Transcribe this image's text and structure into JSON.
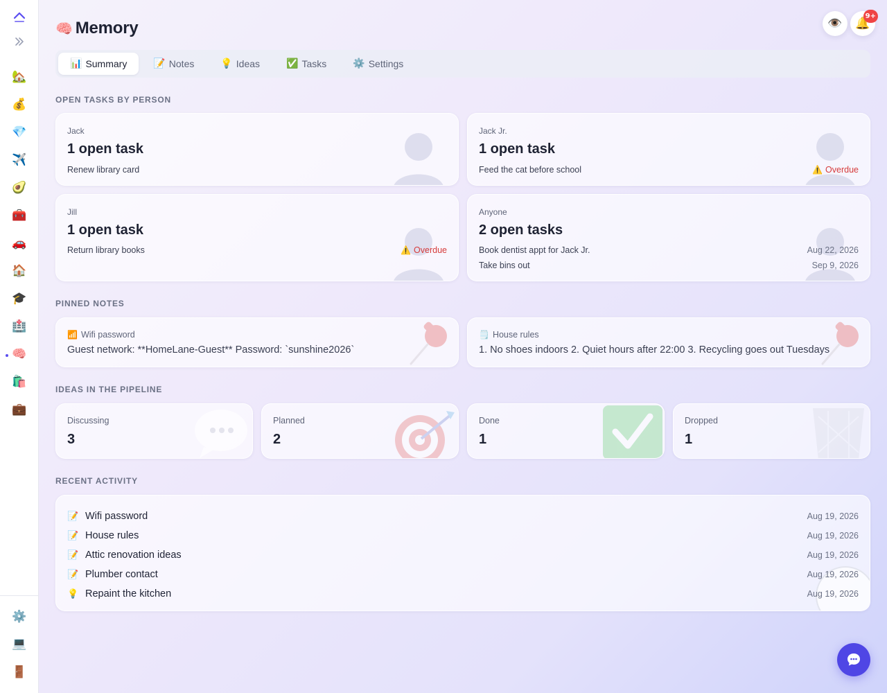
{
  "sidebar": {
    "logo_icon": "chevron-up-logo-icon",
    "expand_icon": "double-chevron-right-icon",
    "items": [
      {
        "name": "home-garden",
        "icon": "🏡"
      },
      {
        "name": "money",
        "icon": "💰"
      },
      {
        "name": "gem",
        "icon": "💎"
      },
      {
        "name": "travel",
        "icon": "✈️"
      },
      {
        "name": "food",
        "icon": "🥑"
      },
      {
        "name": "toolbox",
        "icon": "🧰"
      },
      {
        "name": "car",
        "icon": "🚗"
      },
      {
        "name": "house",
        "icon": "🏠"
      },
      {
        "name": "education",
        "icon": "🎓"
      },
      {
        "name": "health",
        "icon": "🏥"
      },
      {
        "name": "memory",
        "icon": "🧠",
        "active": true
      },
      {
        "name": "shopping",
        "icon": "🛍️"
      },
      {
        "name": "work",
        "icon": "💼"
      }
    ],
    "bottom_items": [
      {
        "name": "settings",
        "icon": "⚙️"
      },
      {
        "name": "computer",
        "icon": "💻"
      },
      {
        "name": "logout-door",
        "icon": "🚪"
      }
    ]
  },
  "header": {
    "title_emoji": "🧠",
    "title": "Memory",
    "eye_icon": "👁️",
    "bell_icon": "🔔",
    "notification_badge": "9+"
  },
  "tabs": [
    {
      "emoji": "📊",
      "label": "Summary",
      "active": true
    },
    {
      "emoji": "📝",
      "label": "Notes"
    },
    {
      "emoji": "💡",
      "label": "Ideas"
    },
    {
      "emoji": "✅",
      "label": "Tasks"
    },
    {
      "emoji": "⚙️",
      "label": "Settings"
    }
  ],
  "open_tasks": {
    "section_label": "OPEN TASKS BY PERSON",
    "overdue_emoji": "⚠️",
    "cards": [
      {
        "person": "Jack",
        "count_label": "1 open task",
        "tasks": [
          {
            "text": "Renew library card",
            "status": ""
          }
        ]
      },
      {
        "person": "Jack Jr.",
        "count_label": "1 open task",
        "tasks": [
          {
            "text": "Feed the cat before school",
            "status": "Overdue"
          }
        ]
      },
      {
        "person": "Jill",
        "count_label": "1 open task",
        "tasks": [
          {
            "text": "Return library books",
            "status": "Overdue"
          }
        ]
      },
      {
        "person": "Anyone",
        "count_label": "2 open tasks",
        "tasks": [
          {
            "text": "Book dentist appt for Jack Jr.",
            "status": "Aug 22, 2026"
          },
          {
            "text": "Take bins out",
            "status": "Sep 9, 2026"
          }
        ]
      }
    ]
  },
  "pinned_notes": {
    "section_label": "PINNED NOTES",
    "notes": [
      {
        "emoji": "📶",
        "title": "Wifi password",
        "body": "Guest network: **HomeLane-Guest** Password: `sunshine2026`"
      },
      {
        "emoji": "🗒️",
        "title": "House rules",
        "body": "1. No shoes indoors 2. Quiet hours after 22:00 3. Recycling goes out Tuesdays"
      }
    ]
  },
  "ideas": {
    "section_label": "IDEAS IN THE PIPELINE",
    "stages": [
      {
        "label": "Discussing",
        "count": "3"
      },
      {
        "label": "Planned",
        "count": "2"
      },
      {
        "label": "Done",
        "count": "1"
      },
      {
        "label": "Dropped",
        "count": "1"
      }
    ]
  },
  "recent_activity": {
    "section_label": "RECENT ACTIVITY",
    "items": [
      {
        "emoji": "📝",
        "title": "Wifi password",
        "date": "Aug 19, 2026"
      },
      {
        "emoji": "📝",
        "title": "House rules",
        "date": "Aug 19, 2026"
      },
      {
        "emoji": "📝",
        "title": "Attic renovation ideas",
        "date": "Aug 19, 2026"
      },
      {
        "emoji": "📝",
        "title": "Plumber contact",
        "date": "Aug 19, 2026"
      },
      {
        "emoji": "💡",
        "title": "Repaint the kitchen",
        "date": "Aug 19, 2026"
      }
    ]
  },
  "colors": {
    "accent": "#4f46e5",
    "overdue": "#d63b3b",
    "badge": "#ef4444"
  }
}
